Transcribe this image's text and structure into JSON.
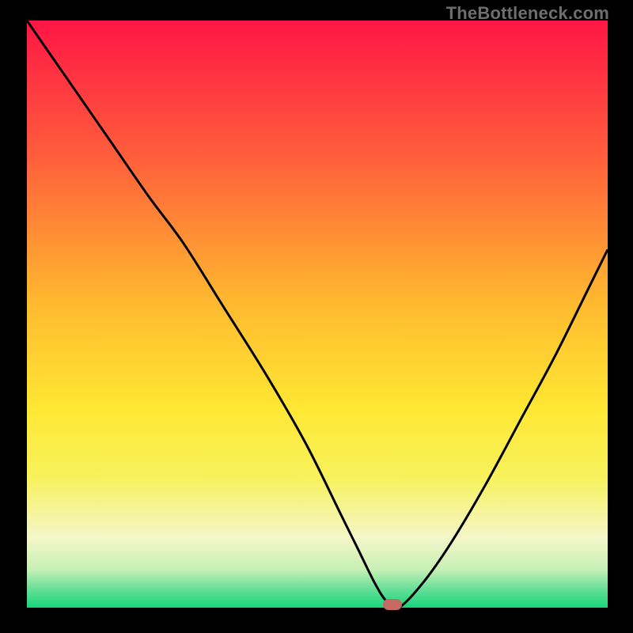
{
  "watermark": "TheBottleneck.com",
  "colors": {
    "black": "#000000",
    "gradient_top": "#ff1645",
    "gradient_mid1": "#ff6a3a",
    "gradient_mid2": "#ffcf2e",
    "gradient_mid3": "#f7ee4a",
    "gradient_mid4": "#f4f6b2",
    "gradient_green_light": "#9ee8a0",
    "gradient_green": "#17d57b",
    "curve": "#000000",
    "marker": "#c46a62"
  },
  "chart_data": {
    "type": "line",
    "title": "",
    "xlabel": "",
    "ylabel": "",
    "xlim": [
      0,
      100
    ],
    "ylim": [
      0,
      100
    ],
    "series": [
      {
        "name": "bottleneck-curve",
        "x": [
          0,
          7,
          14,
          21,
          27,
          34,
          41,
          48,
          54,
          57,
          60,
          62,
          64,
          68,
          73,
          79,
          85,
          91,
          97,
          100
        ],
        "values": [
          100,
          90,
          80,
          70,
          62,
          51,
          40,
          28,
          16,
          10,
          4,
          1,
          0,
          4,
          11,
          21,
          32,
          43,
          55,
          61
        ]
      }
    ],
    "marker": {
      "x": 63,
      "y": 0
    },
    "background_gradient": {
      "stops": [
        {
          "offset": 0.0,
          "color": "#ff1645"
        },
        {
          "offset": 0.22,
          "color": "#ff5a3c"
        },
        {
          "offset": 0.48,
          "color": "#ffb92f"
        },
        {
          "offset": 0.66,
          "color": "#ffe733"
        },
        {
          "offset": 0.78,
          "color": "#f7f25d"
        },
        {
          "offset": 0.88,
          "color": "#f4f6c8"
        },
        {
          "offset": 0.935,
          "color": "#c7f0b6"
        },
        {
          "offset": 0.965,
          "color": "#6fe09a"
        },
        {
          "offset": 1.0,
          "color": "#17d57b"
        }
      ]
    }
  }
}
